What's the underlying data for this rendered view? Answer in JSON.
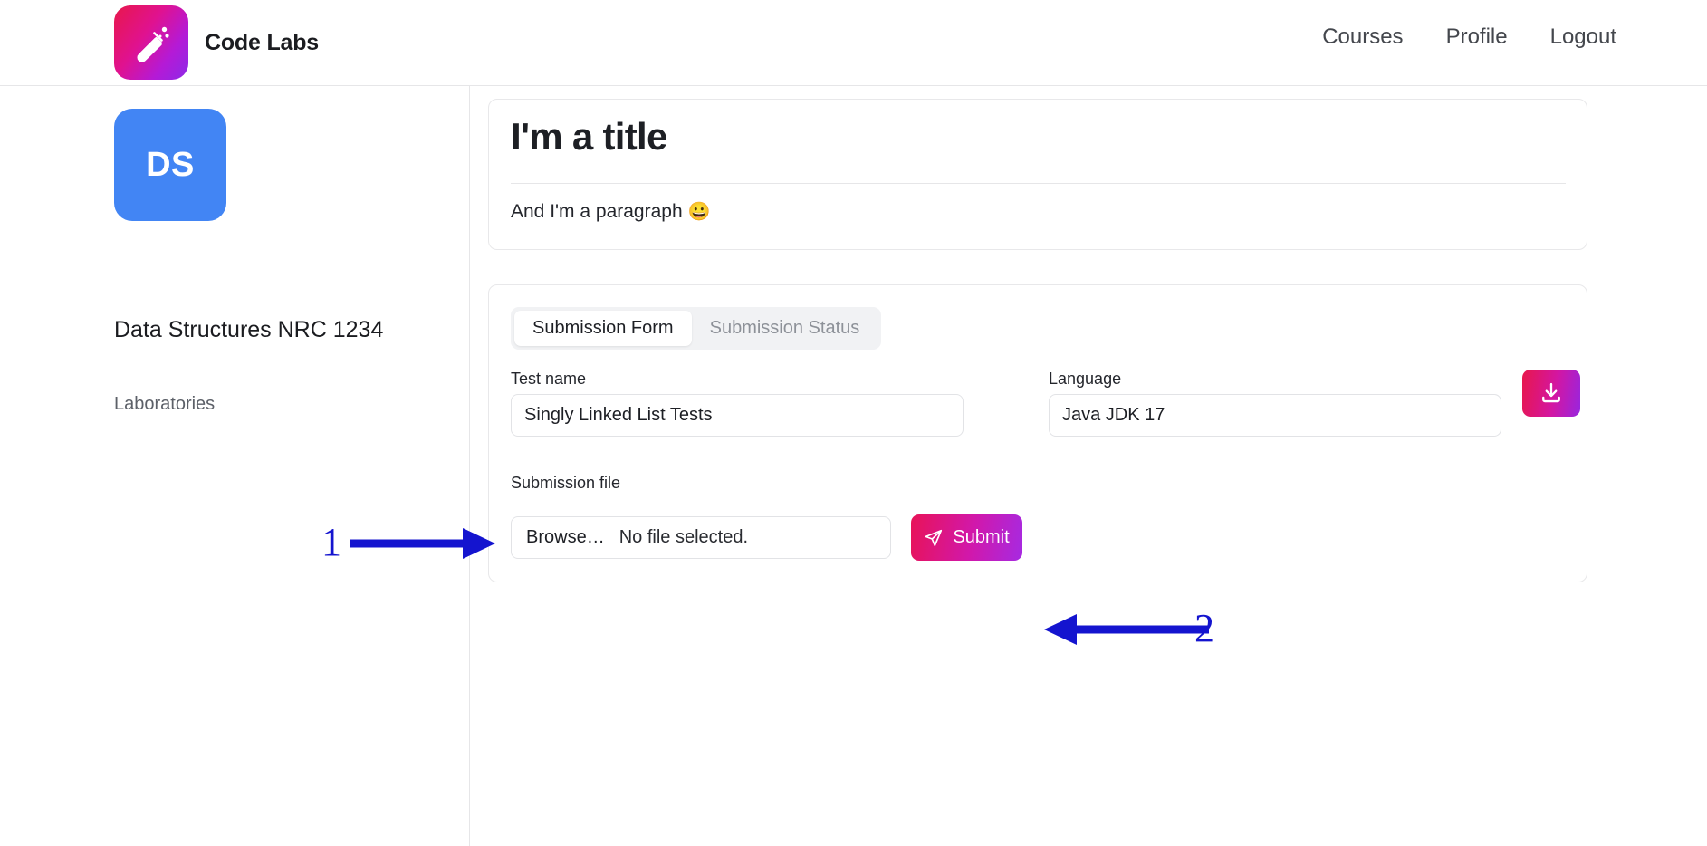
{
  "header": {
    "brand_name": "Code Labs",
    "logo_icon": "test-tube-icon",
    "nav": [
      {
        "label": "Courses"
      },
      {
        "label": "Profile"
      },
      {
        "label": "Logout"
      }
    ]
  },
  "sidebar": {
    "course_initials": "DS",
    "course_name": "Data Structures NRC 1234",
    "section_label": "Laboratories"
  },
  "intro_card": {
    "title": "I'm a title",
    "paragraph": "And I'm a paragraph ",
    "paragraph_emoji": "😀"
  },
  "form_card": {
    "tabs": [
      {
        "label": "Submission Form",
        "active": true
      },
      {
        "label": "Submission Status",
        "active": false
      }
    ],
    "test_name": {
      "label": "Test name",
      "value": "Singly Linked List Tests"
    },
    "language": {
      "label": "Language",
      "value": "Java JDK 17"
    },
    "download_button": {
      "icon": "download-icon"
    },
    "submission_file": {
      "label": "Submission file",
      "browse_label": "Browse…",
      "file_status": "No file selected."
    },
    "submit_button": {
      "label": "Submit",
      "icon": "send-icon"
    }
  },
  "annotations": [
    {
      "number": "1",
      "target": "submission-file-input",
      "direction": "right"
    },
    {
      "number": "2",
      "target": "submit-button",
      "direction": "left"
    }
  ],
  "colors": {
    "brand_gradient_start": "#e8174b",
    "brand_gradient_end": "#8d2ae8",
    "course_tile": "#4285f4",
    "annotation_blue": "#1414cf",
    "text_primary": "#1d1f24",
    "text_muted": "#8d9198",
    "border": "#e6e6e8"
  }
}
